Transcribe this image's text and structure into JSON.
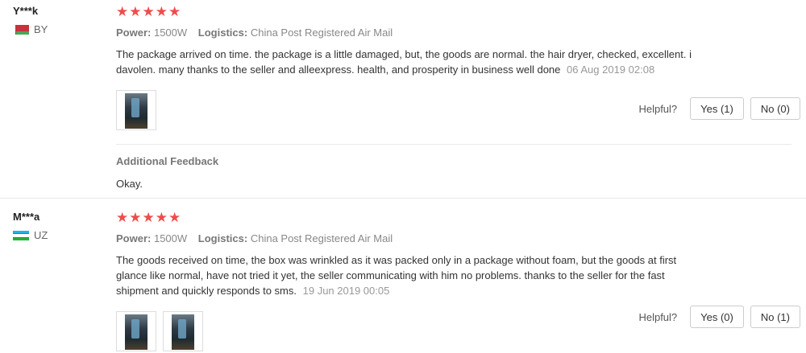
{
  "reviews": [
    {
      "user_name": "Y***k",
      "country_code": "BY",
      "stars": "★★★★★",
      "power_label": "Power:",
      "power_value": "1500W",
      "logistics_label": "Logistics:",
      "logistics_value": "China Post Registered Air Mail",
      "text": "The package arrived on time. the package is a little damaged, but, the goods are normal. the hair dryer, checked, excellent. i davolen. many thanks to the seller and alleexpress. health, and prosperity in business well done",
      "date": "06 Aug 2019 02:08",
      "helpful_label": "Helpful?",
      "yes_label": "Yes (1)",
      "no_label": "No (0)",
      "additional_feedback_title": "Additional Feedback",
      "additional_feedback_text": "Okay."
    },
    {
      "user_name": "M***a",
      "country_code": "UZ",
      "stars": "★★★★★",
      "power_label": "Power:",
      "power_value": "1500W",
      "logistics_label": "Logistics:",
      "logistics_value": "China Post Registered Air Mail",
      "text": "The goods received on time, the box was wrinkled as it was packed only in a package without foam, but the goods at first glance like normal, have not tried it yet, the seller communicating with him no problems. thanks to the seller for the fast shipment and quickly responds to sms.",
      "date": "19 Jun 2019 00:05",
      "helpful_label": "Helpful?",
      "yes_label": "Yes (0)",
      "no_label": "No (1)"
    }
  ],
  "colors": {
    "star": "#ef4c4c",
    "muted": "#999999"
  }
}
